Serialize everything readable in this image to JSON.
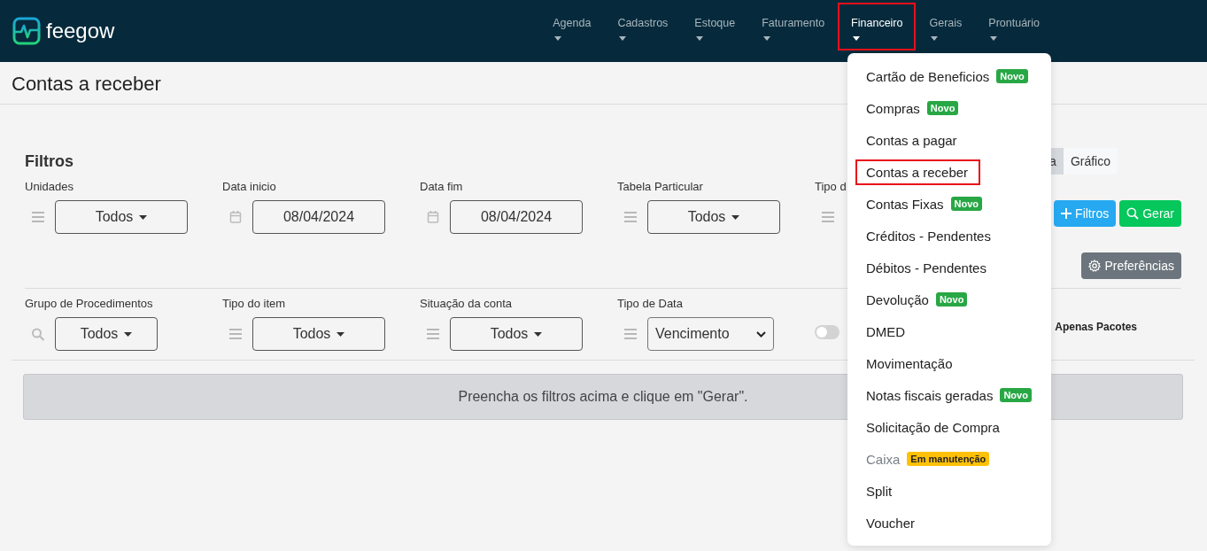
{
  "brand": {
    "name": "feegow"
  },
  "nav": [
    {
      "label": "Agenda",
      "selected": false
    },
    {
      "label": "Cadastros",
      "selected": false
    },
    {
      "label": "Estoque",
      "selected": false
    },
    {
      "label": "Faturamento",
      "selected": false
    },
    {
      "label": "Financeiro",
      "selected": true
    },
    {
      "label": "Gerais",
      "selected": false
    },
    {
      "label": "Prontuário",
      "selected": false
    }
  ],
  "page_title": "Contas a receber",
  "filters": {
    "title": "Filtros",
    "view_tabs": [
      {
        "label": "a",
        "selected": true
      },
      {
        "label": "Gráfico",
        "selected": false
      }
    ],
    "row_1": [
      {
        "label": "Unidades",
        "kind": "dropdown",
        "value": "Todos"
      },
      {
        "label": "Data inicio",
        "kind": "date",
        "value": "08/04/2024"
      },
      {
        "label": "Data fim",
        "kind": "date",
        "value": "08/04/2024"
      },
      {
        "label": "Tabela Particular",
        "kind": "dropdown",
        "value": "Todos"
      },
      {
        "label": "Tipo d",
        "kind": "hidden"
      }
    ],
    "actions": [
      {
        "label": "Filtros",
        "kind": "add"
      },
      {
        "label": "Gerar",
        "kind": "search"
      }
    ],
    "preferences_button": "Preferências",
    "row_2": [
      {
        "label": "Grupo de Procedimentos",
        "kind": "search_dropdown",
        "value": "Todos"
      },
      {
        "label": "Tipo do item",
        "kind": "dropdown",
        "value": "Todos"
      },
      {
        "label": "Situação da conta",
        "kind": "dropdown",
        "value": "Todos"
      },
      {
        "label": "Tipo de Data",
        "kind": "select",
        "value": "Vencimento"
      }
    ],
    "packages_toggle": {
      "label": "Apenas Pacotes",
      "on": false
    }
  },
  "notice": "Preencha os filtros acima e clique em \"Gerar\".",
  "menu": [
    {
      "label": "Cartão de Beneficios",
      "selected": false,
      "disabled": false,
      "badge": {
        "text": "Novo",
        "kind": "new"
      }
    },
    {
      "label": "Compras",
      "selected": false,
      "disabled": false,
      "badge": {
        "text": "Novo",
        "kind": "new"
      }
    },
    {
      "label": "Contas a pagar",
      "selected": false,
      "disabled": false
    },
    {
      "label": "Contas a receber",
      "selected": true,
      "disabled": false
    },
    {
      "label": "Contas Fixas",
      "selected": false,
      "disabled": false,
      "badge": {
        "text": "Novo",
        "kind": "new"
      }
    },
    {
      "label": "Créditos - Pendentes",
      "selected": false,
      "disabled": false
    },
    {
      "label": "Débitos - Pendentes",
      "selected": false,
      "disabled": false
    },
    {
      "label": "Devolução",
      "selected": false,
      "disabled": false,
      "badge": {
        "text": "Novo",
        "kind": "new"
      }
    },
    {
      "label": "DMED",
      "selected": false,
      "disabled": false
    },
    {
      "label": "Movimentação",
      "selected": false,
      "disabled": false
    },
    {
      "label": "Notas fiscais geradas",
      "selected": false,
      "disabled": false,
      "badge": {
        "text": "Novo",
        "kind": "new"
      }
    },
    {
      "label": "Solicitação de Compra",
      "selected": false,
      "disabled": false
    },
    {
      "label": "Caixa",
      "selected": false,
      "disabled": true,
      "badge": {
        "text": "Em manutenção",
        "kind": "maintenance"
      }
    },
    {
      "label": "Split",
      "selected": false,
      "disabled": false
    },
    {
      "label": "Voucher",
      "selected": false,
      "disabled": false
    }
  ]
}
